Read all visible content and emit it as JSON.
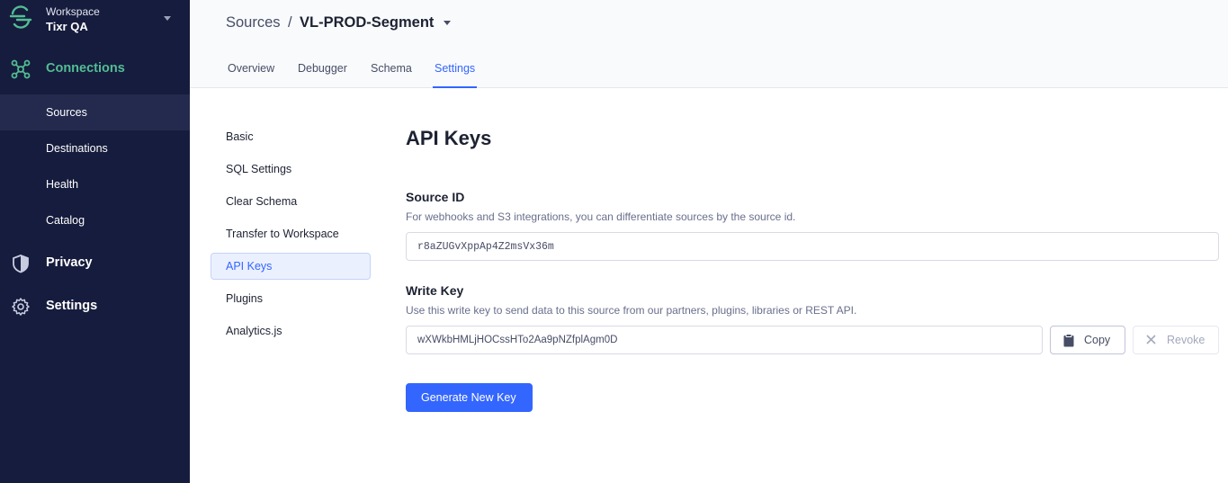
{
  "workspace": {
    "label": "Workspace",
    "name": "Tixr QA"
  },
  "sidebar": {
    "connections": "Connections",
    "sub_items": [
      "Sources",
      "Destinations",
      "Health",
      "Catalog"
    ],
    "privacy": "Privacy",
    "settings": "Settings"
  },
  "breadcrumb": {
    "root": "Sources",
    "separator": "/",
    "current": "VL-PROD-Segment"
  },
  "tabs": [
    "Overview",
    "Debugger",
    "Schema",
    "Settings"
  ],
  "settings_menu": [
    "Basic",
    "SQL Settings",
    "Clear Schema",
    "Transfer to Workspace",
    "API Keys",
    "Plugins",
    "Analytics.js"
  ],
  "page": {
    "title": "API Keys",
    "source_id": {
      "title": "Source ID",
      "description": "For webhooks and S3 integrations, you can differentiate sources by the source id.",
      "value": "r8aZUGvXppAp4Z2msVx36m"
    },
    "write_key": {
      "title": "Write Key",
      "description": "Use this write key to send data to this source from our partners, plugins, libraries or REST API.",
      "value": "wXWkbHMLjHOCssHTo2Aa9pNZfplAgm0D",
      "copy_label": "Copy",
      "revoke_label": "Revoke"
    },
    "generate_label": "Generate New Key"
  },
  "colors": {
    "sidebar_bg": "#161c3d",
    "accent": "#3366ff",
    "connections_green": "#52bd94"
  }
}
